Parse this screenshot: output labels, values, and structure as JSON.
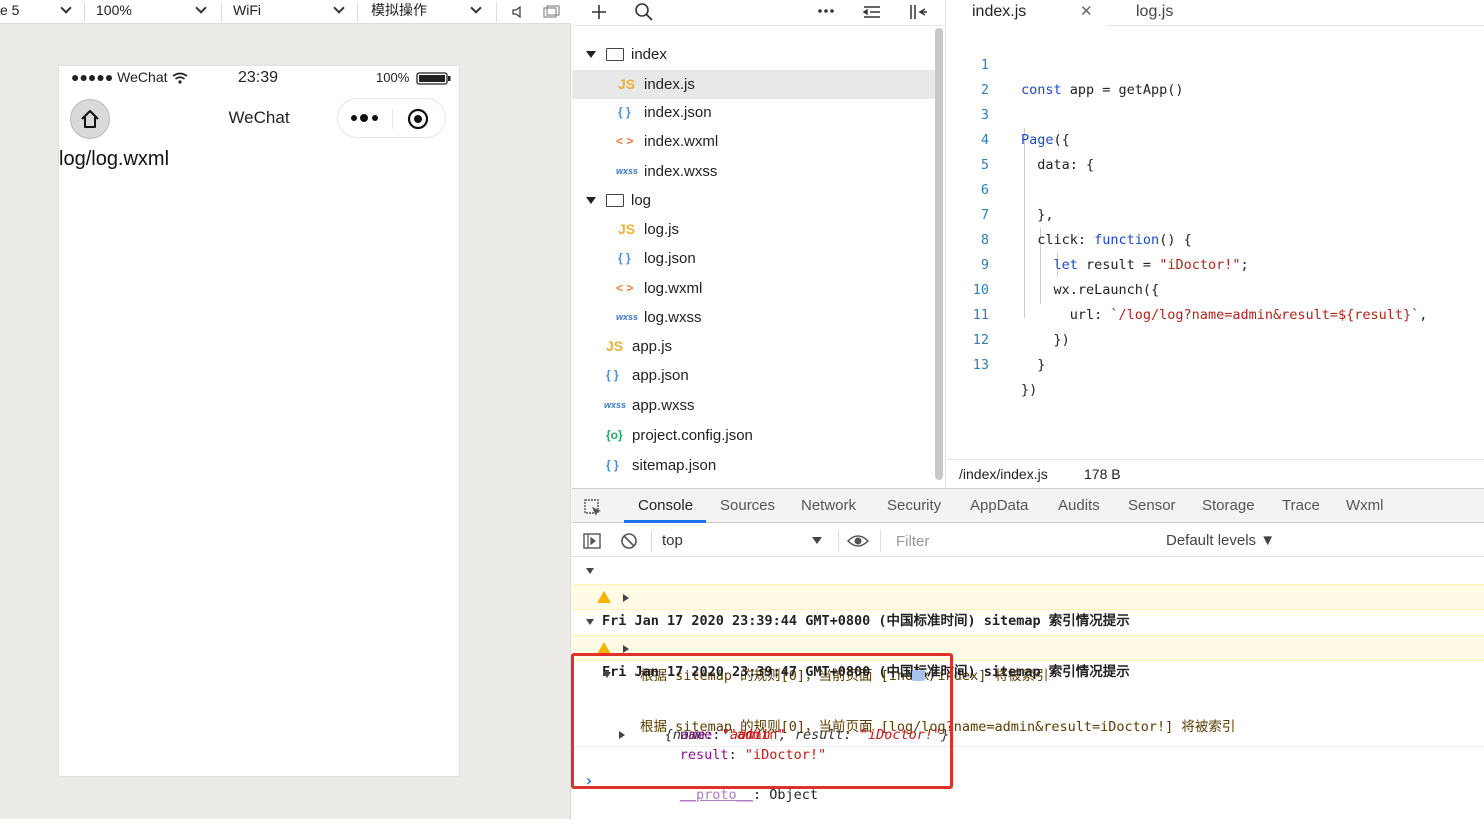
{
  "sim_toolbar": {
    "device": "e 5",
    "zoom": "100%",
    "network": "WiFi",
    "operation": "模拟操作"
  },
  "phone": {
    "carrier": "●●●●● WeChat",
    "time": "23:39",
    "battery": "100%",
    "nav_title": "WeChat",
    "page_text": "log/log.wxml"
  },
  "file_tree": {
    "items": [
      {
        "label": "index",
        "type": "folder"
      },
      {
        "label": "index.js",
        "type": "js"
      },
      {
        "label": "index.json",
        "type": "json"
      },
      {
        "label": "index.wxml",
        "type": "wxml"
      },
      {
        "label": "index.wxss",
        "type": "wxss"
      },
      {
        "label": "log",
        "type": "folder"
      },
      {
        "label": "log.js",
        "type": "js"
      },
      {
        "label": "log.json",
        "type": "json"
      },
      {
        "label": "log.wxml",
        "type": "wxml"
      },
      {
        "label": "log.wxss",
        "type": "wxss"
      },
      {
        "label": "app.js",
        "type": "js"
      },
      {
        "label": "app.json",
        "type": "json"
      },
      {
        "label": "app.wxss",
        "type": "wxss"
      },
      {
        "label": "project.config.json",
        "type": "config"
      },
      {
        "label": "sitemap.json",
        "type": "json"
      }
    ],
    "icons": {
      "js": "JS",
      "json": "{ }",
      "wxml": "< >",
      "wxss": "wxss",
      "config": "{o}"
    }
  },
  "editor": {
    "tabs": [
      {
        "label": "index.js"
      },
      {
        "label": "log.js"
      }
    ],
    "close_glyph": "✕",
    "lines": [
      {
        "n": "1",
        "code": "const app = getApp()"
      },
      {
        "n": "2",
        "code": ""
      },
      {
        "n": "3",
        "code": "Page({"
      },
      {
        "n": "4",
        "code": "  data: {"
      },
      {
        "n": "5",
        "code": ""
      },
      {
        "n": "6",
        "code": "  },"
      },
      {
        "n": "7",
        "code": "  click: function() {"
      },
      {
        "n": "8",
        "code": "    let result = \"iDoctor!\";"
      },
      {
        "n": "9",
        "code": "    wx.reLaunch({"
      },
      {
        "n": "10",
        "code": "      url: `/log/log?name=admin&result=${result}`,"
      },
      {
        "n": "11",
        "code": "    })"
      },
      {
        "n": "12",
        "code": "  }"
      },
      {
        "n": "13",
        "code": "})"
      }
    ],
    "status_path": "/index/index.js",
    "status_size": "178 B"
  },
  "devtools": {
    "tabs": [
      "Console",
      "Sources",
      "Network",
      "Security",
      "AppData",
      "Audits",
      "Sensor",
      "Storage",
      "Trace",
      "Wxml"
    ],
    "context": "top",
    "filter_placeholder": "Filter",
    "levels": "Default levels ▼",
    "logs": [
      {
        "kind": "group",
        "text": "Fri Jan 17 2020 23:39:44 GMT+0800 (中国标准时间) sitemap 索引情况提示"
      },
      {
        "kind": "warn",
        "text": "根据 sitemap 的规则[0]，当前页面 [index/index] 将被索引"
      },
      {
        "kind": "group",
        "text": "Fri Jan 17 2020 23:39:47 GMT+0800 (中国标准时间) sitemap 索引情况提示"
      },
      {
        "kind": "warn",
        "text": "根据 sitemap 的规则[0]，当前页面 [log/log?name=admin&result=iDoctor!] 将被索引"
      }
    ],
    "object": {
      "summary_prefix": "{name: ",
      "summary_name": "\"admin\"",
      "summary_mid": ", result: ",
      "summary_result": "\"iDoctor!\"",
      "summary_suffix": "}",
      "name_key": "name",
      "name_val": "\"admin\"",
      "result_key": "result",
      "result_val": "\"iDoctor!\"",
      "proto_key": "__proto__",
      "proto_val": ": Object"
    },
    "prompt": "›"
  }
}
